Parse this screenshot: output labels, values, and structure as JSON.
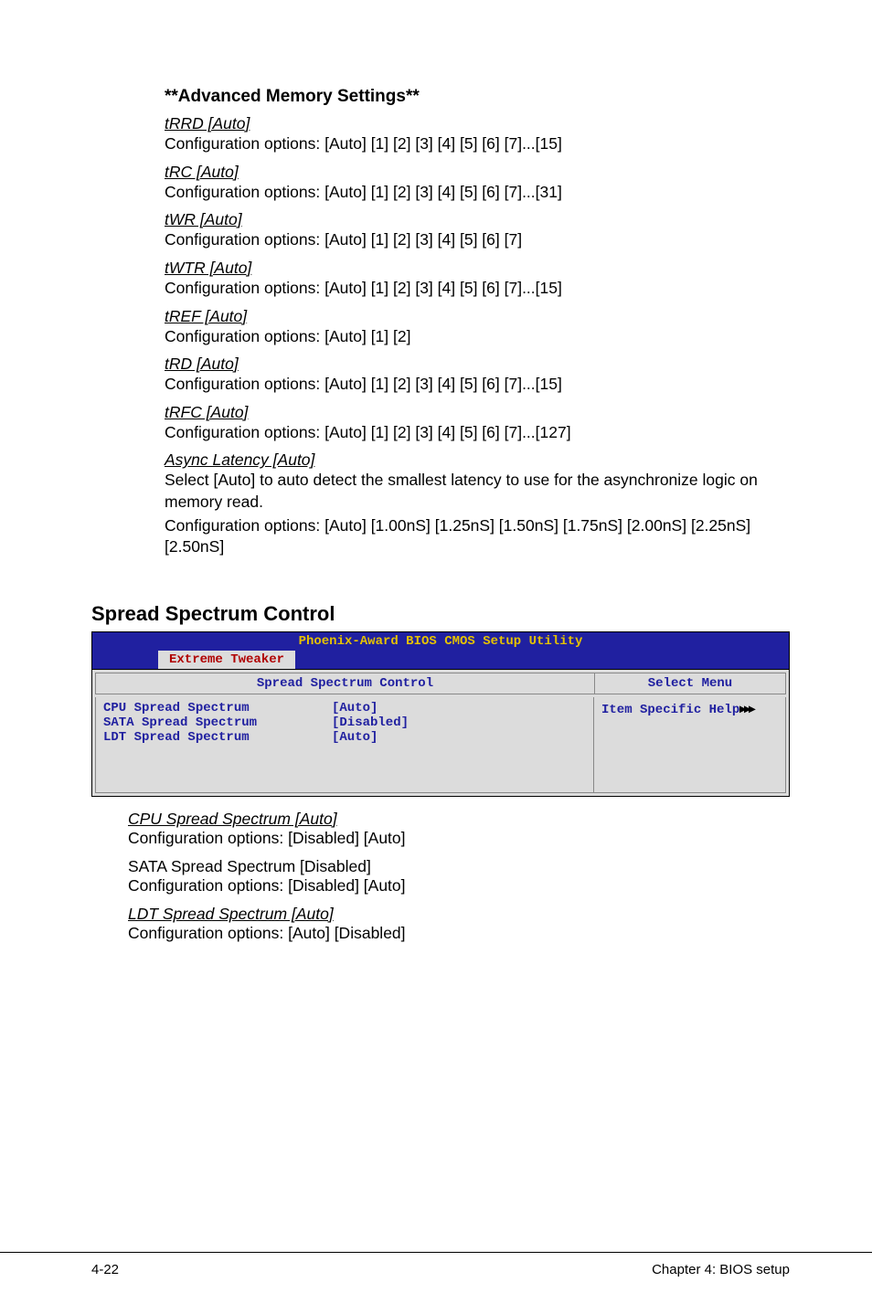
{
  "advanced": {
    "title": "**Advanced Memory Settings**",
    "items": [
      {
        "name": "tRRD [Auto]",
        "desc": "Configuration options: [Auto] [1] [2] [3] [4] [5] [6] [7]...[15]"
      },
      {
        "name": "tRC [Auto]",
        "desc": "Configuration options: [Auto] [1] [2] [3] [4] [5] [6] [7]...[31]"
      },
      {
        "name": "tWR [Auto]",
        "desc": "Configuration options: [Auto] [1] [2] [3] [4] [5] [6] [7]"
      },
      {
        "name": "tWTR [Auto]",
        "desc": "Configuration options: [Auto] [1] [2] [3] [4] [5] [6] [7]...[15]"
      },
      {
        "name": "tREF [Auto]",
        "desc": "Configuration options: [Auto] [1] [2]"
      },
      {
        "name": "tRD [Auto]",
        "desc": "Configuration options: [Auto] [1] [2] [3] [4] [5] [6] [7]...[15]"
      },
      {
        "name": "tRFC [Auto]",
        "desc": "Configuration options: [Auto] [1] [2] [3] [4] [5] [6] [7]...[127]"
      }
    ],
    "async": {
      "name": "Async Latency [Auto]",
      "desc1": "Select [Auto] to auto detect the smallest latency to use for the asynchronize logic on memory read.",
      "desc2": "Configuration options: [Auto] [1.00nS] [1.25nS] [1.50nS] [1.75nS] [2.00nS] [2.25nS] [2.50nS]"
    }
  },
  "spread": {
    "title": "Spread Spectrum Control",
    "bios": {
      "header": "Phoenix-Award BIOS CMOS Setup Utility",
      "tab": "Extreme Tweaker",
      "sub_left": "Spread Spectrum Control",
      "sub_right": "Select Menu",
      "rows": [
        {
          "label": "CPU Spread Spectrum",
          "value": "[Auto]"
        },
        {
          "label": "SATA Spread Spectrum",
          "value": "[Disabled]"
        },
        {
          "label": "LDT Spread Spectrum",
          "value": "[Auto]"
        }
      ],
      "help": "Item Specific Help",
      "arrows": "▸▸▸"
    },
    "post": [
      {
        "name": "CPU Spread Spectrum [Auto]",
        "desc": "Configuration options: [Disabled] [Auto]",
        "link": true
      },
      {
        "name": "SATA Spread Spectrum [Disabled]",
        "desc": "Configuration options: [Disabled] [Auto]",
        "link": false
      },
      {
        "name": "LDT Spread Spectrum [Auto]",
        "desc": "Configuration options: [Auto] [Disabled]",
        "link": true
      }
    ]
  },
  "footer": {
    "left": "4-22",
    "right": "Chapter 4: BIOS setup"
  }
}
